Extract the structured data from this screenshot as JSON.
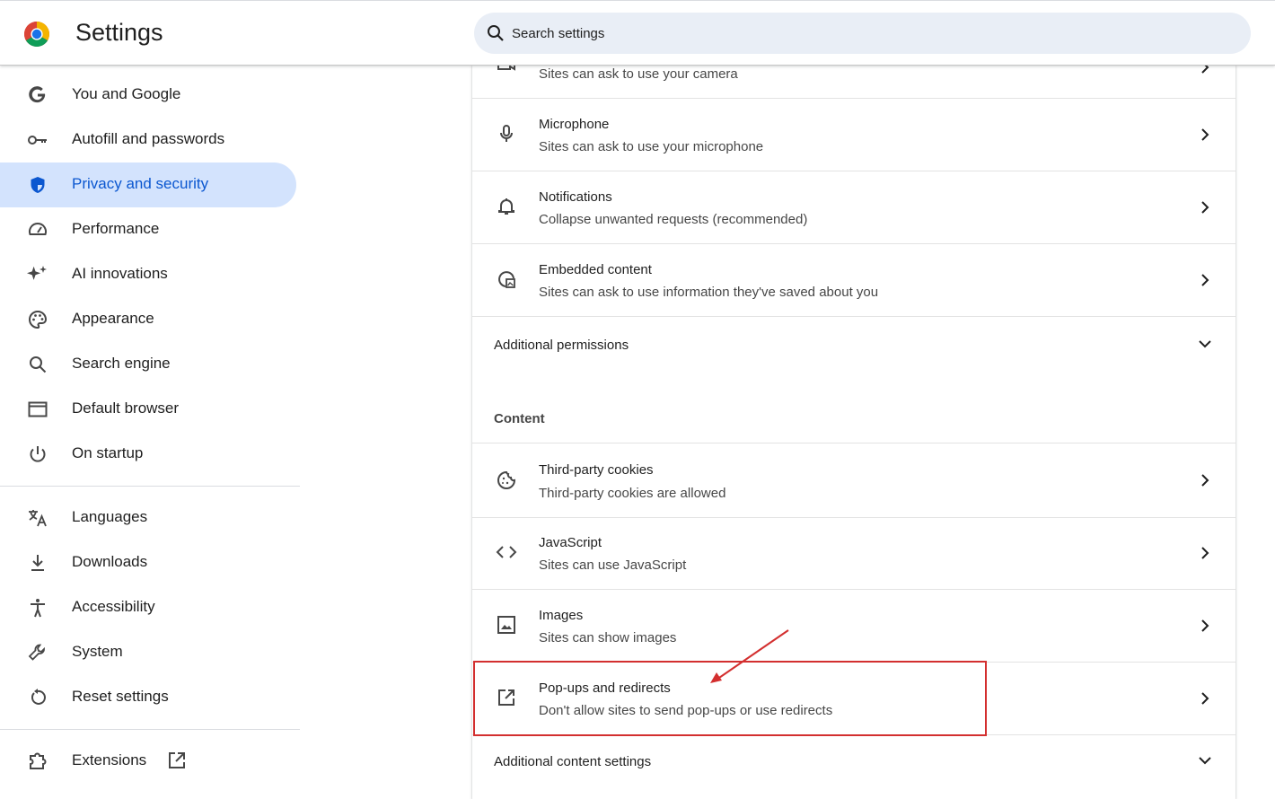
{
  "header": {
    "title": "Settings",
    "search_placeholder": "Search settings"
  },
  "sidebar": {
    "items": [
      {
        "label": "You and Google",
        "icon": "google-g-icon"
      },
      {
        "label": "Autofill and passwords",
        "icon": "key-icon"
      },
      {
        "label": "Privacy and security",
        "icon": "shield-icon",
        "active": true
      },
      {
        "label": "Performance",
        "icon": "speedometer-icon"
      },
      {
        "label": "AI innovations",
        "icon": "sparkle-icon"
      },
      {
        "label": "Appearance",
        "icon": "palette-icon"
      },
      {
        "label": "Search engine",
        "icon": "search-icon"
      },
      {
        "label": "Default browser",
        "icon": "browser-window-icon"
      },
      {
        "label": "On startup",
        "icon": "power-icon"
      }
    ],
    "items2": [
      {
        "label": "Languages",
        "icon": "translate-icon"
      },
      {
        "label": "Downloads",
        "icon": "download-icon"
      },
      {
        "label": "Accessibility",
        "icon": "accessibility-icon"
      },
      {
        "label": "System",
        "icon": "wrench-icon"
      },
      {
        "label": "Reset settings",
        "icon": "reset-icon"
      }
    ],
    "extensions": {
      "label": "Extensions",
      "icon": "puzzle-icon"
    }
  },
  "main": {
    "permissions": [
      {
        "title": "",
        "subtitle": "Sites can ask to use your camera",
        "icon": "camera-icon"
      },
      {
        "title": "Microphone",
        "subtitle": "Sites can ask to use your microphone",
        "icon": "microphone-icon"
      },
      {
        "title": "Notifications",
        "subtitle": "Collapse unwanted requests (recommended)",
        "icon": "bell-icon"
      },
      {
        "title": "Embedded content",
        "subtitle": "Sites can ask to use information they've saved about you",
        "icon": "embedded-content-icon"
      }
    ],
    "additional_permissions": "Additional permissions",
    "content_heading": "Content",
    "content": [
      {
        "title": "Third-party cookies",
        "subtitle": "Third-party cookies are allowed",
        "icon": "cookie-icon"
      },
      {
        "title": "JavaScript",
        "subtitle": "Sites can use JavaScript",
        "icon": "code-icon"
      },
      {
        "title": "Images",
        "subtitle": "Sites can show images",
        "icon": "image-icon"
      },
      {
        "title": "Pop-ups and redirects",
        "subtitle": "Don't allow sites to send pop-ups or use redirects",
        "icon": "external-link-icon"
      }
    ],
    "additional_content_settings": "Additional content settings"
  },
  "colors": {
    "accent": "#0b57d0",
    "active_bg": "#d3e3fd",
    "annotation": "#d32f2f"
  }
}
